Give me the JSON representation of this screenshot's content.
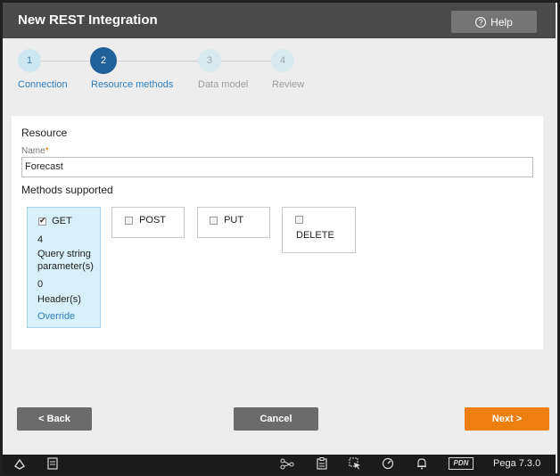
{
  "header": {
    "title": "New REST Integration",
    "help_label": "Help"
  },
  "stepper": [
    {
      "number": "1",
      "label": "Connection"
    },
    {
      "number": "2",
      "label": "Resource methods"
    },
    {
      "number": "3",
      "label": "Data model"
    },
    {
      "number": "4",
      "label": "Review"
    }
  ],
  "resource": {
    "section_title": "Resource",
    "name_label": "Name",
    "required_mark": "*",
    "name_value": "Forecast",
    "methods_title": "Methods supported"
  },
  "methods": {
    "get": {
      "label": "GET",
      "checked": true,
      "query_count": "4",
      "query_label": "Query string parameter(s)",
      "header_count": "0",
      "header_label": "Header(s)",
      "override_label": "Override"
    },
    "post": {
      "label": "POST",
      "checked": false
    },
    "put": {
      "label": "PUT",
      "checked": false
    },
    "delete": {
      "label": "DELETE",
      "checked": false
    }
  },
  "footer": {
    "back_label": "< Back",
    "cancel_label": "Cancel",
    "next_label": "Next >"
  },
  "taskbar": {
    "icons": [
      "designer-studio-icon",
      "clipboard-list-icon",
      "connections-icon",
      "clipboard-icon",
      "pointer-icon",
      "performance-icon",
      "notification-bell-icon"
    ],
    "pdn_label": "PDN",
    "version": "Pega 7.3.0"
  },
  "colors": {
    "header_bg": "#4a4a4a",
    "active_step": "#21609a",
    "link": "#2f7fbf",
    "next_button": "#ec7f10",
    "selected_method_bg": "#d7f0fa"
  }
}
